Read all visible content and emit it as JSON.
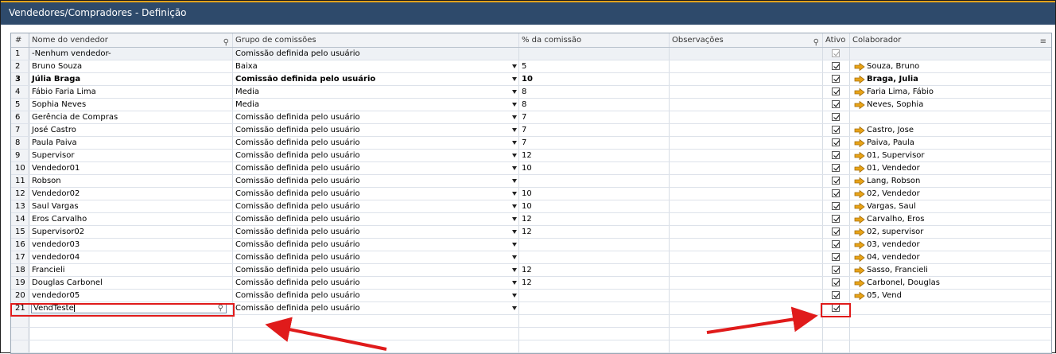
{
  "window": {
    "title": "Vendedores/Compradores - Definição"
  },
  "columns": {
    "num": "#",
    "name": "Nome do vendedor",
    "group": "Grupo de comissões",
    "pct": "% da comissão",
    "obs": "Observações",
    "active": "Ativo",
    "collaborator": "Colaborador"
  },
  "icons": {
    "name_header": "key-icon",
    "obs_header": "key-icon",
    "collaborator_header": "menu-icon",
    "collaborator_link": "arrow-right-icon",
    "dropdown": "triangle-down-icon",
    "checkbox": "checkmark-icon"
  },
  "colors": {
    "title_bar": "#2e4a6b",
    "title_accent": "#e3a21a",
    "link_arrow": "#e8a317",
    "highlight": "#e01b1b"
  },
  "rows": [
    {
      "num": "1",
      "name": "-Nenhum vendedor-",
      "group": "Comissão definida pelo usuário",
      "pct": "",
      "active": true,
      "collaborator": ""
    },
    {
      "num": "2",
      "name": "Bruno Souza",
      "group": "Baixa",
      "pct": "5",
      "active": true,
      "collaborator": "Souza, Bruno"
    },
    {
      "num": "3",
      "name": "Júlia Braga",
      "group": "Comissão definida pelo usuário",
      "pct": "10",
      "active": true,
      "collaborator": "Braga, Julia"
    },
    {
      "num": "4",
      "name": "Fábio Faria Lima",
      "group": "Media",
      "pct": "8",
      "active": true,
      "collaborator": "Faria Lima, Fábio"
    },
    {
      "num": "5",
      "name": "Sophia Neves",
      "group": "Media",
      "pct": "8",
      "active": true,
      "collaborator": "Neves, Sophia"
    },
    {
      "num": "6",
      "name": "Gerência de Compras",
      "group": "Comissão definida pelo usuário",
      "pct": "7",
      "active": true,
      "collaborator": ""
    },
    {
      "num": "7",
      "name": "José Castro",
      "group": "Comissão definida pelo usuário",
      "pct": "7",
      "active": true,
      "collaborator": "Castro, Jose"
    },
    {
      "num": "8",
      "name": "Paula Paiva",
      "group": "Comissão definida pelo usuário",
      "pct": "7",
      "active": true,
      "collaborator": "Paiva, Paula"
    },
    {
      "num": "9",
      "name": "Supervisor",
      "group": "Comissão definida pelo usuário",
      "pct": "12",
      "active": true,
      "collaborator": "01, Supervisor"
    },
    {
      "num": "10",
      "name": "Vendedor01",
      "group": "Comissão definida pelo usuário",
      "pct": "10",
      "active": true,
      "collaborator": "01, Vendedor"
    },
    {
      "num": "11",
      "name": "Robson",
      "group": "Comissão definida pelo usuário",
      "pct": "",
      "active": true,
      "collaborator": "Lang, Robson"
    },
    {
      "num": "12",
      "name": "Vendedor02",
      "group": "Comissão definida pelo usuário",
      "pct": "10",
      "active": true,
      "collaborator": "02, Vendedor"
    },
    {
      "num": "13",
      "name": "Saul Vargas",
      "group": "Comissão definida pelo usuário",
      "pct": "10",
      "active": true,
      "collaborator": "Vargas, Saul"
    },
    {
      "num": "14",
      "name": "Eros Carvalho",
      "group": "Comissão definida pelo usuário",
      "pct": "12",
      "active": true,
      "collaborator": "Carvalho, Eros"
    },
    {
      "num": "15",
      "name": "Supervisor02",
      "group": "Comissão definida pelo usuário",
      "pct": "12",
      "active": true,
      "collaborator": "02, supervisor"
    },
    {
      "num": "16",
      "name": "vendedor03",
      "group": "Comissão definida pelo usuário",
      "pct": "",
      "active": true,
      "collaborator": "03, vendedor"
    },
    {
      "num": "17",
      "name": "vendedor04",
      "group": "Comissão definida pelo usuário",
      "pct": "",
      "active": true,
      "collaborator": "04, vendedor"
    },
    {
      "num": "18",
      "name": "Francieli",
      "group": "Comissão definida pelo usuário",
      "pct": "12",
      "active": true,
      "collaborator": "Sasso, Francieli"
    },
    {
      "num": "19",
      "name": "Douglas Carbonel",
      "group": "Comissão definida pelo usuário",
      "pct": "12",
      "active": true,
      "collaborator": "Carbonel, Douglas"
    },
    {
      "num": "20",
      "name": "vendedor05",
      "group": "Comissão definida pelo usuário",
      "pct": "",
      "active": true,
      "collaborator": "05, Vend"
    },
    {
      "num": "21",
      "name": "VendTeste",
      "group": "Comissão definida pelo usuário",
      "pct": "",
      "active": true,
      "collaborator": ""
    }
  ]
}
